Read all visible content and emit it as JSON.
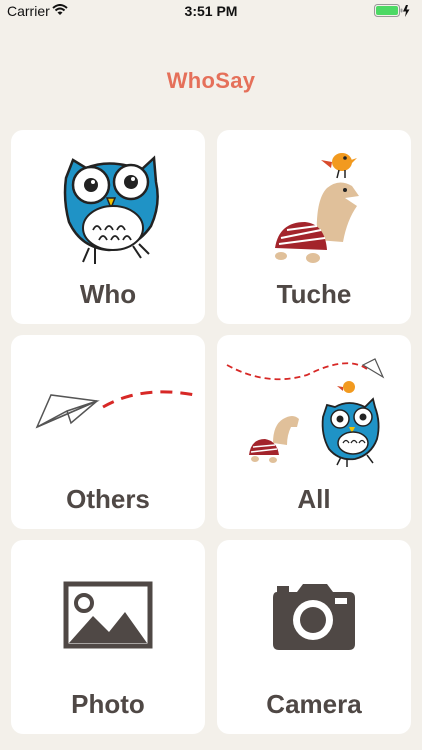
{
  "status_bar": {
    "carrier": "Carrier",
    "time": "3:51 PM"
  },
  "app": {
    "title": "WhoSay"
  },
  "tiles": [
    {
      "label": "Who",
      "icon": "owl-icon"
    },
    {
      "label": "Tuche",
      "icon": "turtle-with-bird-icon"
    },
    {
      "label": "Others",
      "icon": "paper-plane-icon"
    },
    {
      "label": "All",
      "icon": "all-characters-icon"
    },
    {
      "label": "Photo",
      "icon": "photo-icon"
    },
    {
      "label": "Camera",
      "icon": "camera-icon"
    }
  ],
  "colors": {
    "accent": "#e5705a",
    "background": "#f3f0ea",
    "tile": "#ffffff",
    "label": "#4f4845",
    "battery": "#4cd964"
  }
}
